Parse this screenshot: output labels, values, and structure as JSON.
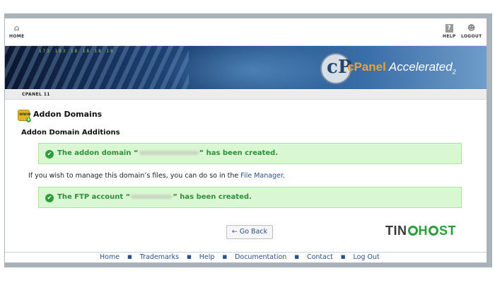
{
  "topnav": {
    "home_label": "HOME",
    "help_label": "HELP",
    "logout_label": "LOGOUT",
    "help_icon_glyph": "?"
  },
  "banner": {
    "ticker": "173   183   18   18   18   18",
    "logo_glyph": "cP",
    "logo_brand": "cPanel",
    "logo_word": "Accelerated",
    "logo_version": "2"
  },
  "breadcrumb": {
    "label": "CPANEL 11"
  },
  "page": {
    "title": "Addon Domains",
    "section": "Addon Domain Additions",
    "icon_text": "www",
    "icon_plus": "+"
  },
  "messages": {
    "domain_created_pre": "The addon domain “",
    "domain_created_post": "” has been created.",
    "ftp_created_pre": "The FTP account “",
    "ftp_created_post": "” has been created.",
    "check_glyph": "✔"
  },
  "info": {
    "text": "If you wish to manage this domain’s files, you can do so in the ",
    "link": "File Manager",
    "end": "."
  },
  "back_button": {
    "label": "← Go Back"
  },
  "watermark": {
    "part1": "TIN",
    "part2": "H",
    "part3": "ST"
  },
  "footer": {
    "links": [
      "Home",
      "Trademarks",
      "Help",
      "Documentation",
      "Contact",
      "Log Out"
    ],
    "separator": "■"
  },
  "colors": {
    "success_bg": "#d9f7d2",
    "success_text": "#2e8f3a",
    "link": "#2c4f8c",
    "brand_green": "#2a9d3a"
  }
}
